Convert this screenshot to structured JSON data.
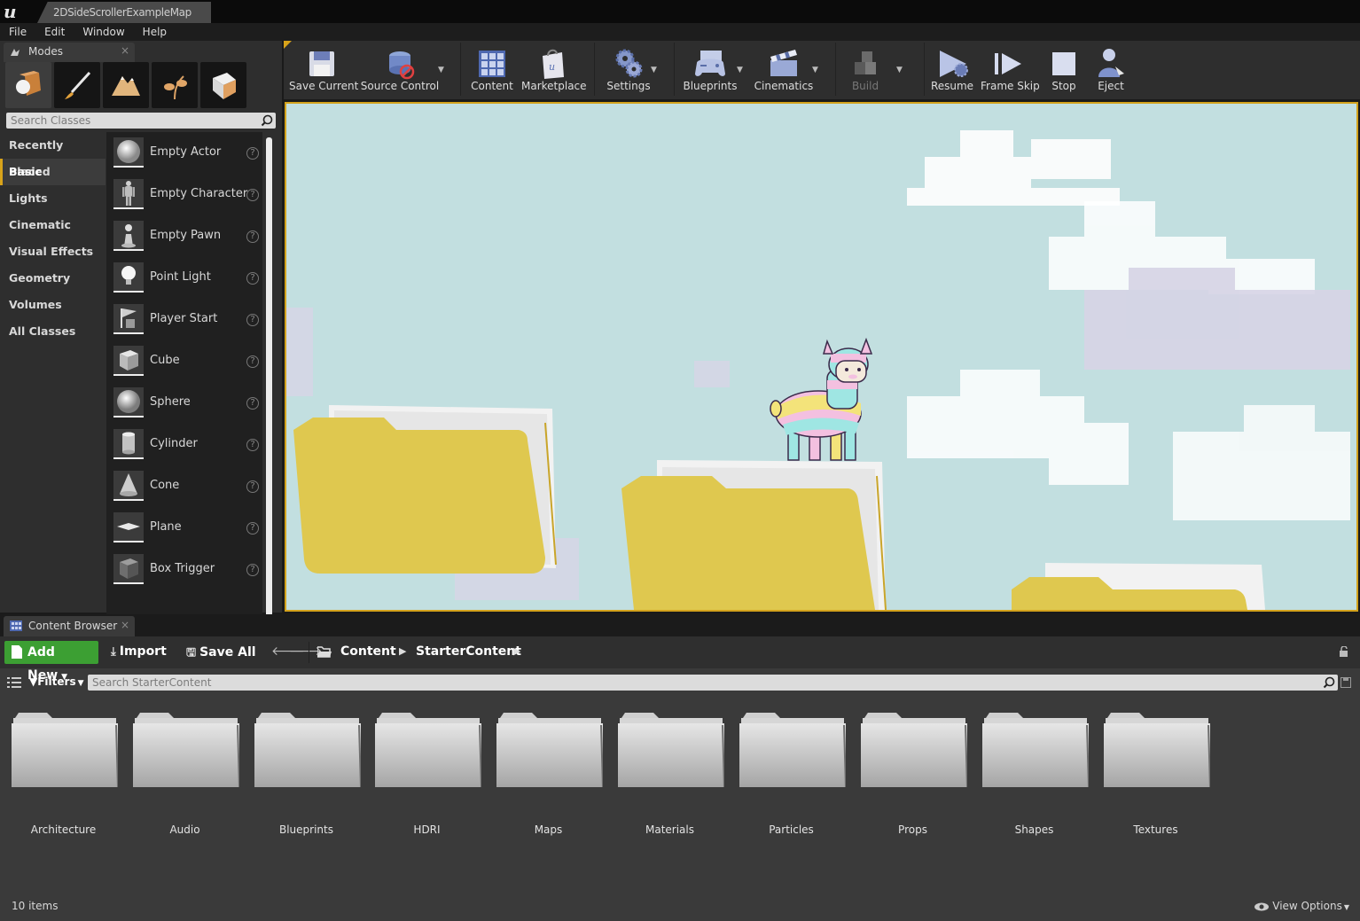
{
  "window": {
    "map_tab": "2DSideScrollerExampleMap"
  },
  "menu": [
    "File",
    "Edit",
    "Window",
    "Help"
  ],
  "modes": {
    "tab_label": "Modes",
    "search_placeholder": "Search Classes",
    "categories": [
      "Recently Placed",
      "Basic",
      "Lights",
      "Cinematic",
      "Visual Effects",
      "Geometry",
      "Volumes",
      "All Classes"
    ],
    "active_category": "Basic",
    "classes": [
      "Empty Actor",
      "Empty Character",
      "Empty Pawn",
      "Point Light",
      "Player Start",
      "Cube",
      "Sphere",
      "Cylinder",
      "Cone",
      "Plane",
      "Box Trigger"
    ]
  },
  "toolbar": {
    "save_current": "Save Current",
    "source_control": "Source Control",
    "content": "Content",
    "marketplace": "Marketplace",
    "settings": "Settings",
    "blueprints": "Blueprints",
    "cinematics": "Cinematics",
    "build": "Build",
    "resume": "Resume",
    "frame_skip": "Frame Skip",
    "stop": "Stop",
    "eject": "Eject"
  },
  "content_browser": {
    "tab_label": "Content Browser",
    "add_new": "Add New",
    "import": "Import",
    "save_all": "Save All",
    "breadcrumb": [
      "Content",
      "StarterContent"
    ],
    "filters": "Filters",
    "search_placeholder": "Search StarterContent",
    "folders": [
      "Architecture",
      "Audio",
      "Blueprints",
      "HDRI",
      "Maps",
      "Materials",
      "Particles",
      "Props",
      "Shapes",
      "Textures"
    ],
    "item_count": "10 items",
    "view_options": "View Options"
  },
  "colors": {
    "accent": "#d3a21c",
    "add_new_green": "#3c9f33",
    "sky": "#bfdcdd",
    "folder_yellow": "#dfc84f"
  }
}
